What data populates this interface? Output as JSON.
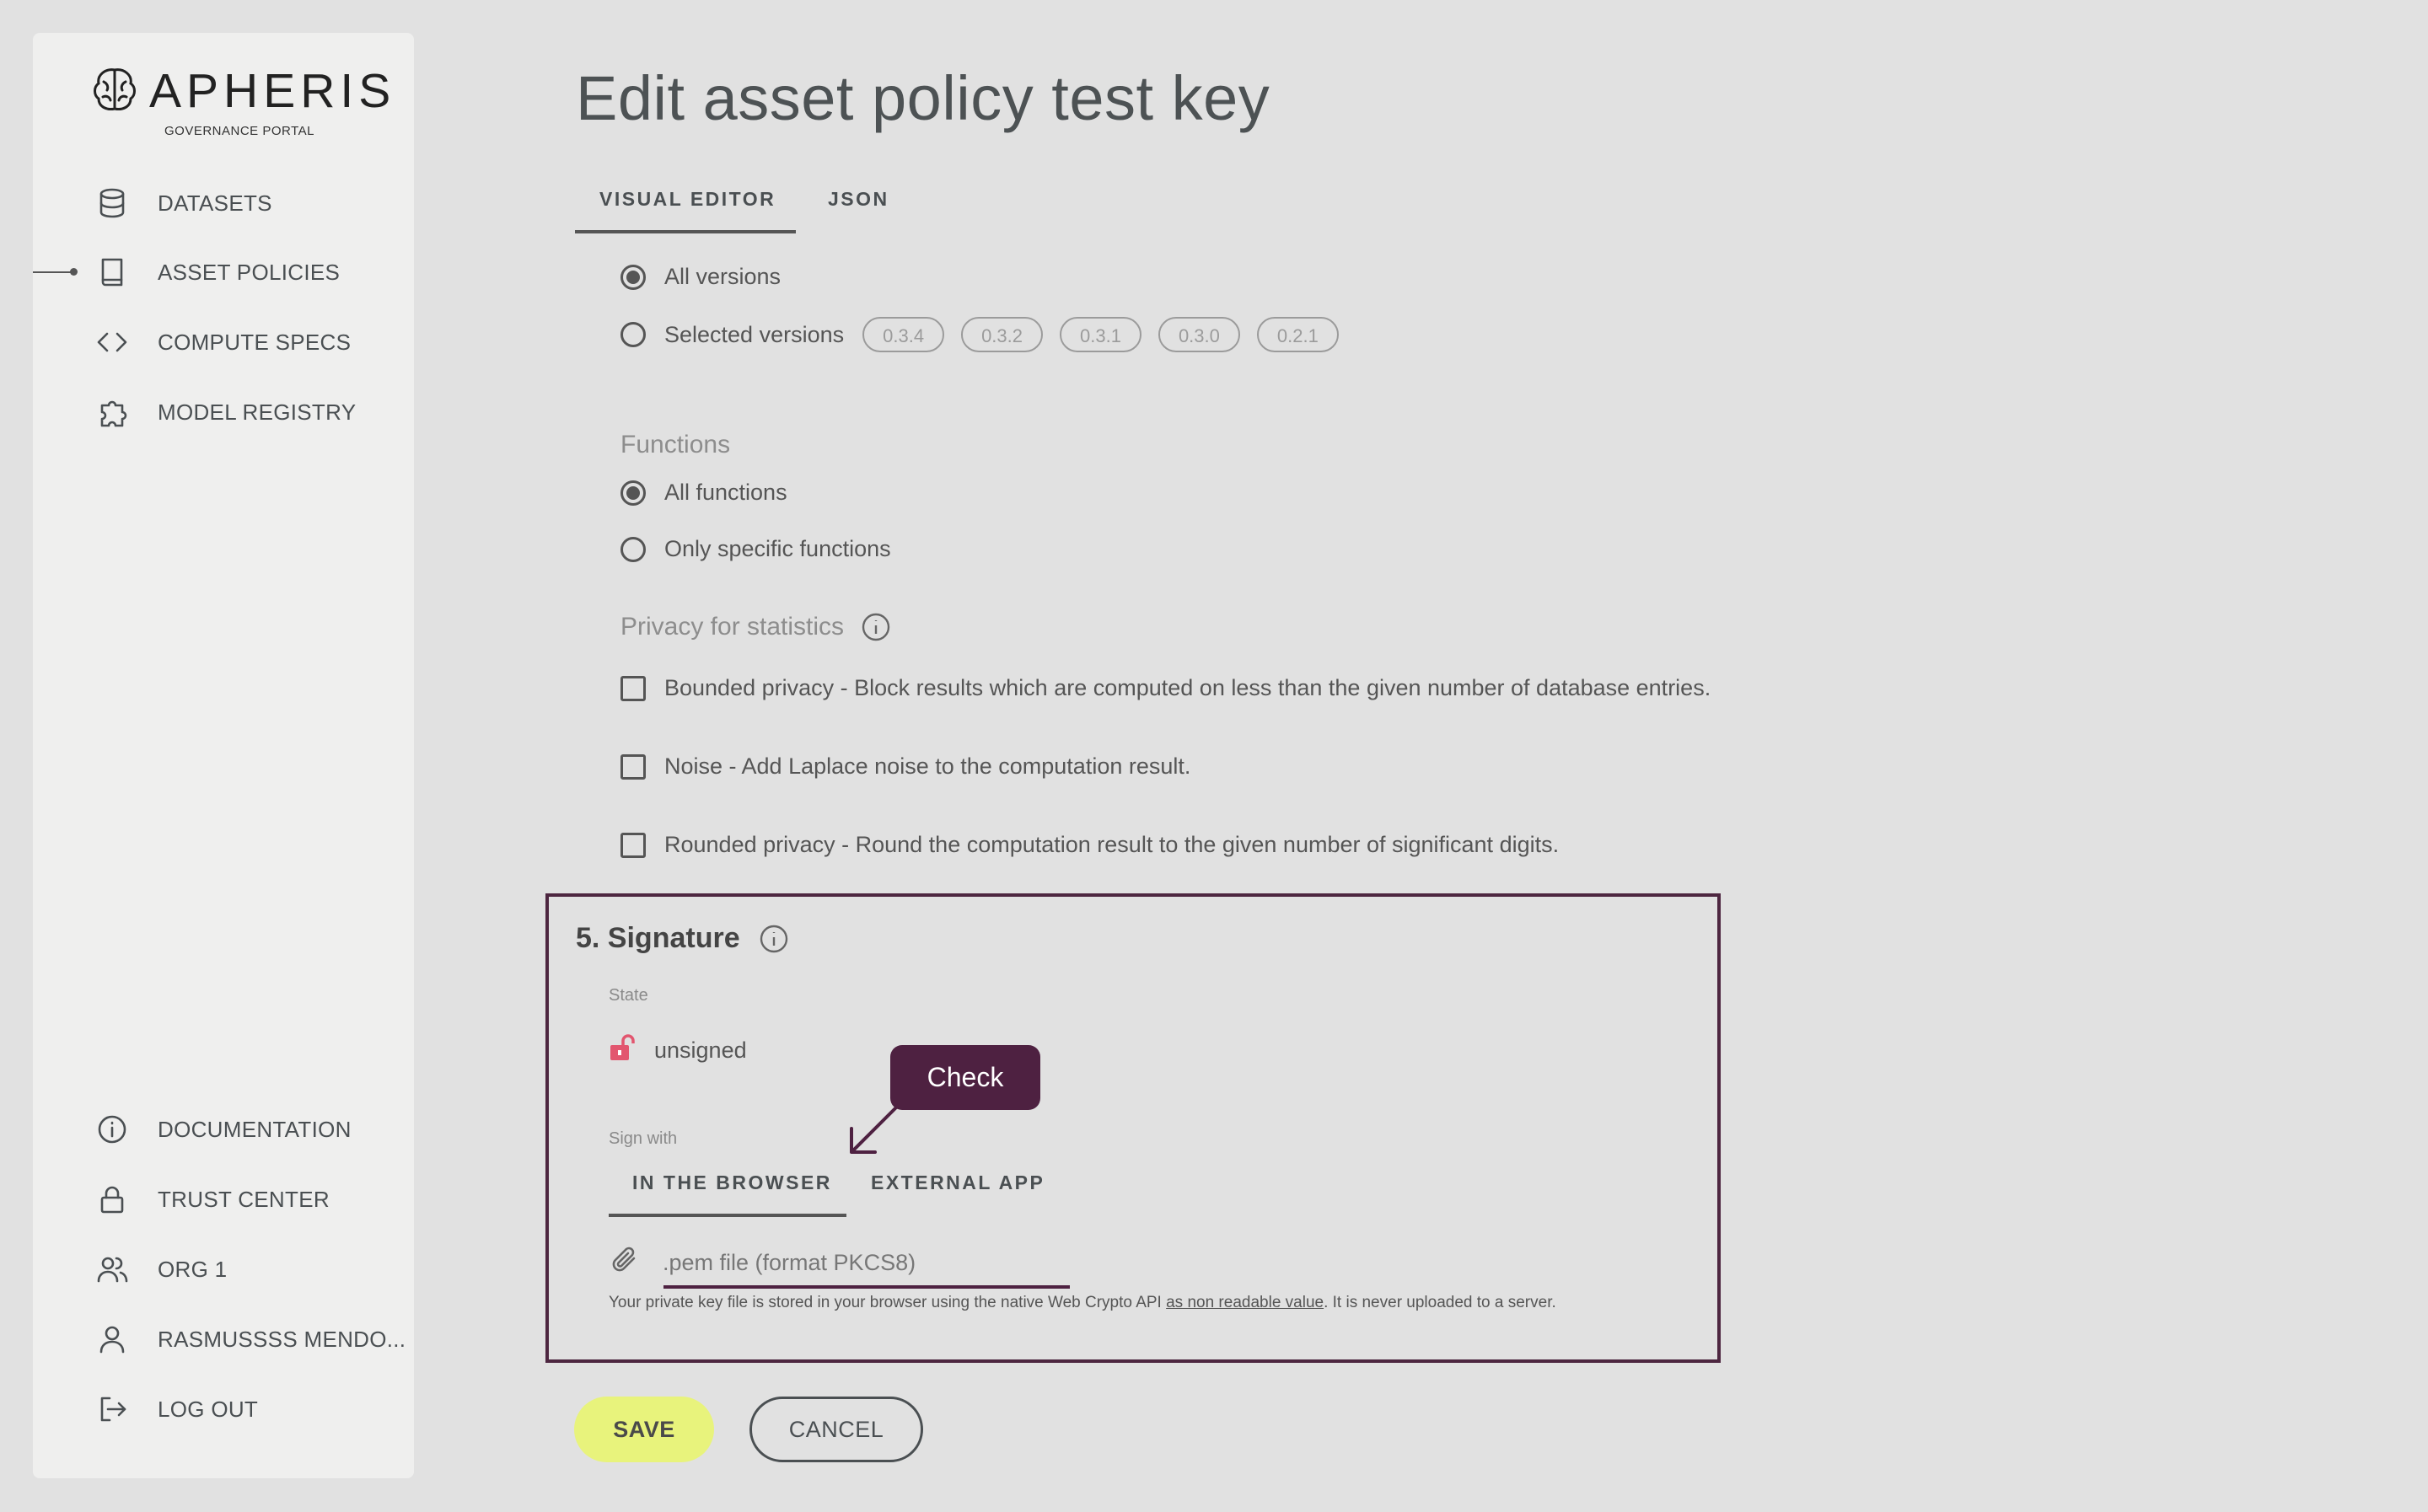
{
  "brand": {
    "name": "APHERIS",
    "subtitle": "GOVERNANCE PORTAL",
    "logo_icon": "brain-icon"
  },
  "sidebar": {
    "items": [
      {
        "label": "DATASETS",
        "icon": "database-icon"
      },
      {
        "label": "ASSET POLICIES",
        "icon": "book-icon",
        "active": true
      },
      {
        "label": "COMPUTE SPECS",
        "icon": "code-icon"
      },
      {
        "label": "MODEL REGISTRY",
        "icon": "puzzle-icon"
      }
    ],
    "bottom_items": [
      {
        "label": "DOCUMENTATION",
        "icon": "info-icon"
      },
      {
        "label": "TRUST CENTER",
        "icon": "lock-icon"
      },
      {
        "label": "ORG 1",
        "icon": "users-icon"
      },
      {
        "label": "RASMUSSSS MENDO...",
        "icon": "user-icon"
      },
      {
        "label": "LOG OUT",
        "icon": "logout-icon"
      }
    ]
  },
  "page": {
    "title": "Edit asset policy test key"
  },
  "tabs": [
    {
      "label": "VISUAL EDITOR",
      "active": true
    },
    {
      "label": "JSON",
      "active": false
    }
  ],
  "versions": {
    "all_label": "All versions",
    "selected_label": "Selected versions",
    "selected_option": "all",
    "chips": [
      "0.3.4",
      "0.3.2",
      "0.3.1",
      "0.3.0",
      "0.2.1"
    ]
  },
  "functions": {
    "heading": "Functions",
    "all_label": "All functions",
    "specific_label": "Only specific functions",
    "selected_option": "all"
  },
  "privacy": {
    "heading": "Privacy for statistics",
    "options": [
      {
        "label": "Bounded privacy - Block results which are computed on less than the given number of database entries.",
        "checked": false
      },
      {
        "label": "Noise - Add Laplace noise to the computation result.",
        "checked": false
      },
      {
        "label": "Rounded privacy - Round the computation result to the given number of significant digits.",
        "checked": false
      }
    ]
  },
  "signature": {
    "heading": "5. Signature",
    "state_label": "State",
    "state_value": "unsigned",
    "sign_with_label": "Sign with",
    "sign_tabs": [
      {
        "label": "IN THE BROWSER",
        "active": true
      },
      {
        "label": "EXTERNAL APP",
        "active": false
      }
    ],
    "file_placeholder": ".pem file (format PKCS8)",
    "help_prefix": "Your private key file is stored in your browser using the native Web Crypto API ",
    "help_link": "as non readable value",
    "help_suffix": ". It is never uploaded to a server.",
    "tooltip": "Check"
  },
  "actions": {
    "save": "SAVE",
    "cancel": "CANCEL"
  },
  "colors": {
    "accent_save": "#e8f37c",
    "highlight_border": "#4d2640",
    "tooltip_bg": "#4e2141",
    "unsigned_lock": "#e2566f"
  }
}
